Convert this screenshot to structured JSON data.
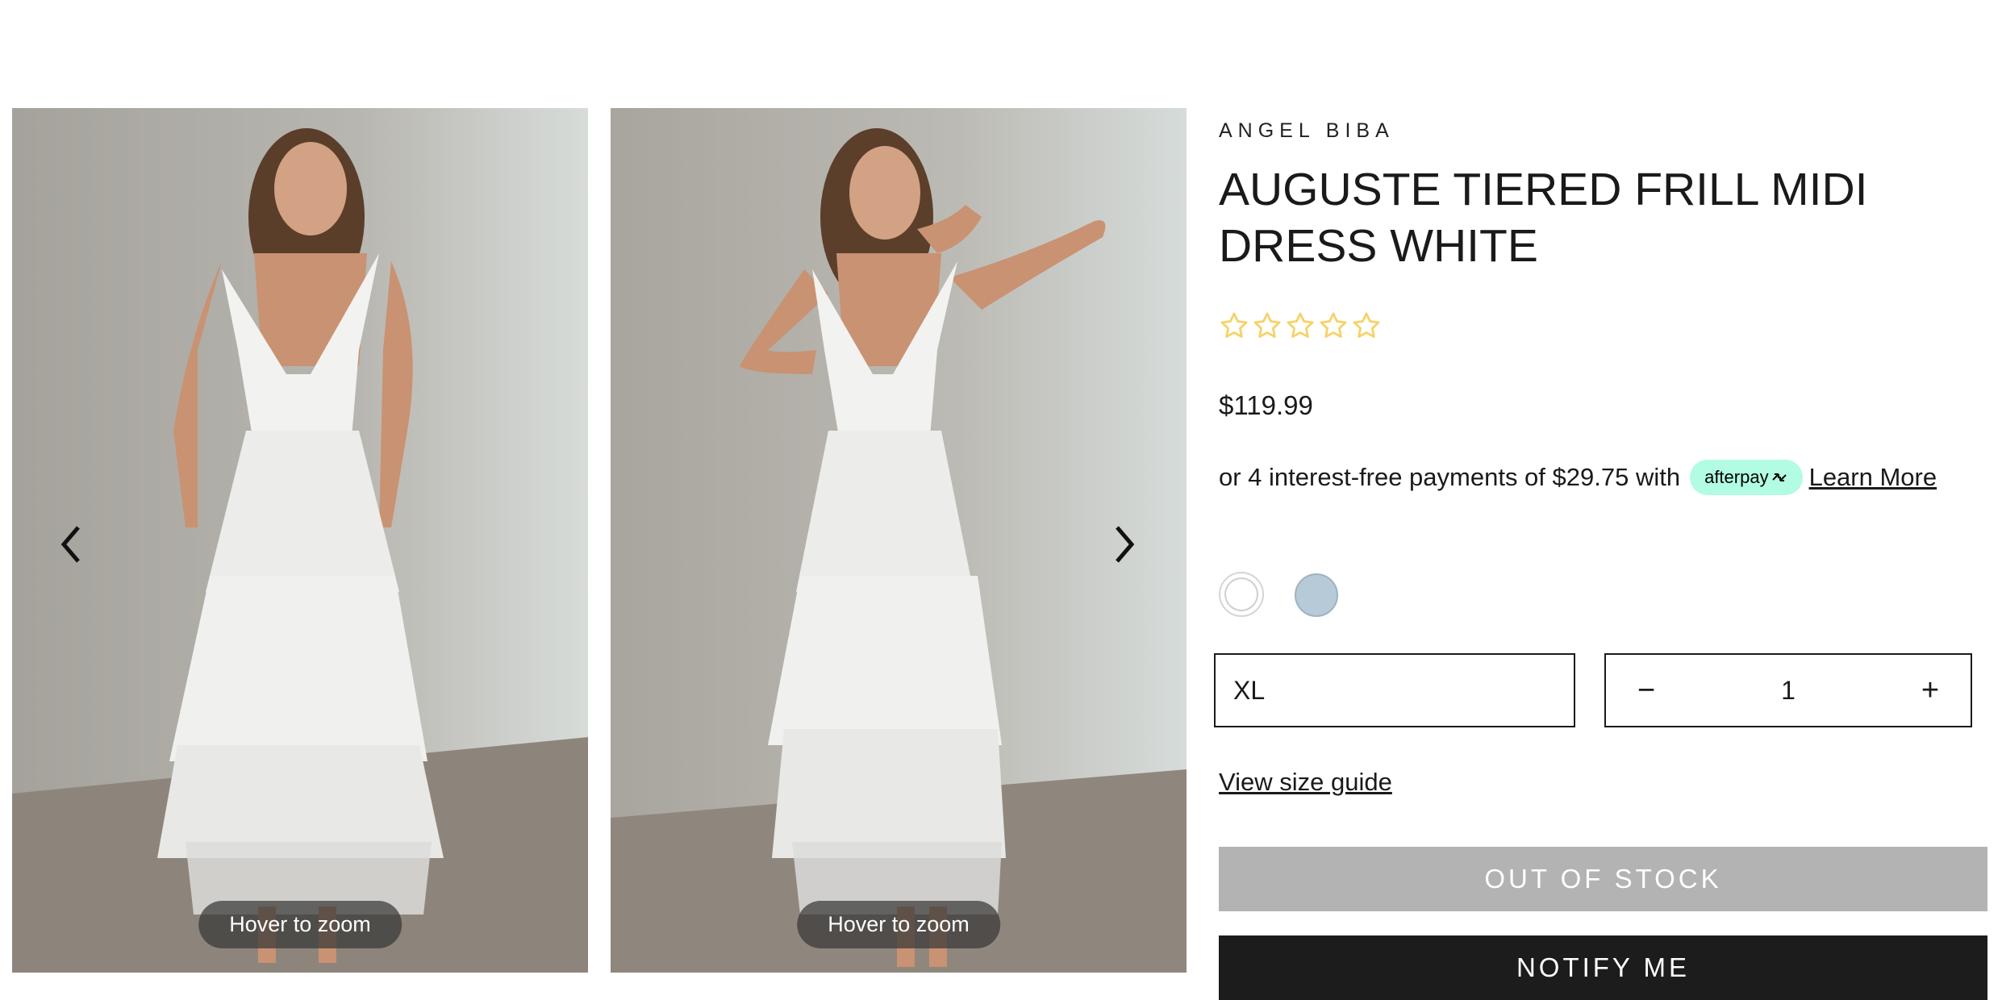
{
  "gallery": {
    "images": [
      {
        "alt": "model-smiling-front",
        "zoom_label": "Hover to zoom"
      },
      {
        "alt": "model-hand-on-hip",
        "zoom_label": "Hover to zoom"
      }
    ],
    "prev_icon": "chevron-left-icon",
    "next_icon": "chevron-right-icon"
  },
  "product": {
    "brand": "ANGEL BIBA",
    "title": "AUGUSTE TIERED FRILL MIDI DRESS WHITE",
    "rating_stars": 5,
    "rating_value": 0,
    "star_color": "#f5d36a",
    "price": "$119.99",
    "afterpay": {
      "text": "or 4 interest-free payments of $29.75 with",
      "badge": "afterpay",
      "badge_color": "#b2fce4",
      "learn_more": "Learn More"
    },
    "colors": [
      {
        "name": "White",
        "hex": "#ffffff",
        "selected": true
      },
      {
        "name": "Blue",
        "hex": "#b6cad8",
        "selected": false
      }
    ],
    "size_selected": "XL",
    "quantity": {
      "minus": "−",
      "value": "1",
      "plus": "+"
    },
    "size_guide": "View size guide",
    "out_of_stock": "OUT OF STOCK",
    "notify": "NOTIFY ME"
  }
}
